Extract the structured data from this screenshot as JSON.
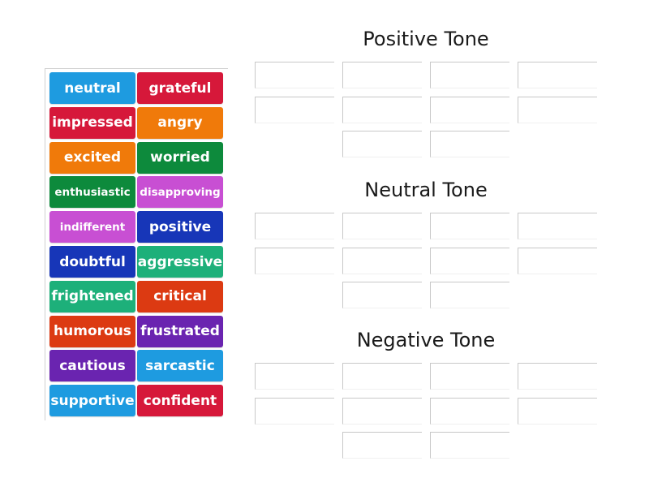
{
  "tiles": [
    {
      "label": "neutral",
      "color": "#1e9be0"
    },
    {
      "label": "grateful",
      "color": "#d6183a"
    },
    {
      "label": "impressed",
      "color": "#d6183a"
    },
    {
      "label": "angry",
      "color": "#f07a0a"
    },
    {
      "label": "excited",
      "color": "#f07a0a"
    },
    {
      "label": "worried",
      "color": "#0d8a3c"
    },
    {
      "label": "enthusiastic",
      "color": "#0d8a3c"
    },
    {
      "label": "disapproving",
      "color": "#c84fd3"
    },
    {
      "label": "indifferent",
      "color": "#c84fd3"
    },
    {
      "label": "positive",
      "color": "#1736b8"
    },
    {
      "label": "doubtful",
      "color": "#1736b8"
    },
    {
      "label": "aggressive",
      "color": "#1db07a"
    },
    {
      "label": "frightened",
      "color": "#1db07a"
    },
    {
      "label": "critical",
      "color": "#dc3a12"
    },
    {
      "label": "humorous",
      "color": "#dc3a12"
    },
    {
      "label": "frustrated",
      "color": "#6a24b0"
    },
    {
      "label": "cautious",
      "color": "#6a24b0"
    },
    {
      "label": "sarcastic",
      "color": "#1e9be0"
    },
    {
      "label": "supportive",
      "color": "#1e9be0"
    },
    {
      "label": "confident",
      "color": "#d6183a"
    }
  ],
  "groups": [
    {
      "title": "Positive Tone",
      "slot_count": 10
    },
    {
      "title": "Neutral Tone",
      "slot_count": 10
    },
    {
      "title": "Negative Tone",
      "slot_count": 10
    }
  ]
}
